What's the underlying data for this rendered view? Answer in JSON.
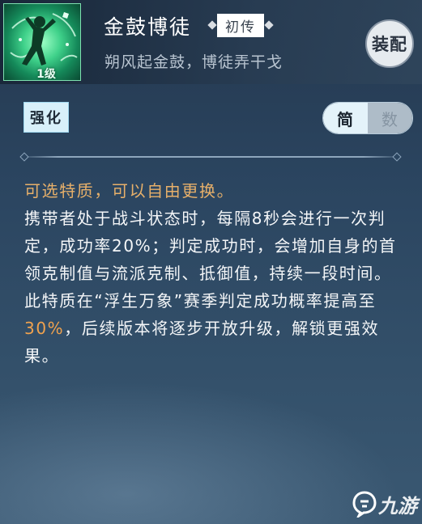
{
  "header": {
    "title": "金鼓博徒",
    "rarity": "初传",
    "subtitle": "朔风起金鼓，博徒弄干戈",
    "icon_level": "1级",
    "equip_label": "装配"
  },
  "tabs": {
    "enhance_label": "强化"
  },
  "toggle": {
    "simple_label": "简",
    "number_label": "数",
    "selected": "简"
  },
  "description": {
    "line_gold": "可选特质，可以自由更换。",
    "para1": "携带者处于战斗状态时，每隔8秒会进行一次判定，成功率20%；判定成功时，会增加自身的首领克制值与流派克制、抵御值，持续一段时间。",
    "para2_before": "此特质在“浮生万象”赛季判定成功概率提高至",
    "para2_highlight": "30%",
    "para2_after": "，后续版本将逐步开放升级，解锁更强效果。"
  },
  "watermark": {
    "text": "九游"
  },
  "colors": {
    "highlight_gold": "#e7b06a",
    "highlight_orange": "#f0a24e",
    "icon_green": "#3fd18a",
    "background": "#2b4560"
  }
}
